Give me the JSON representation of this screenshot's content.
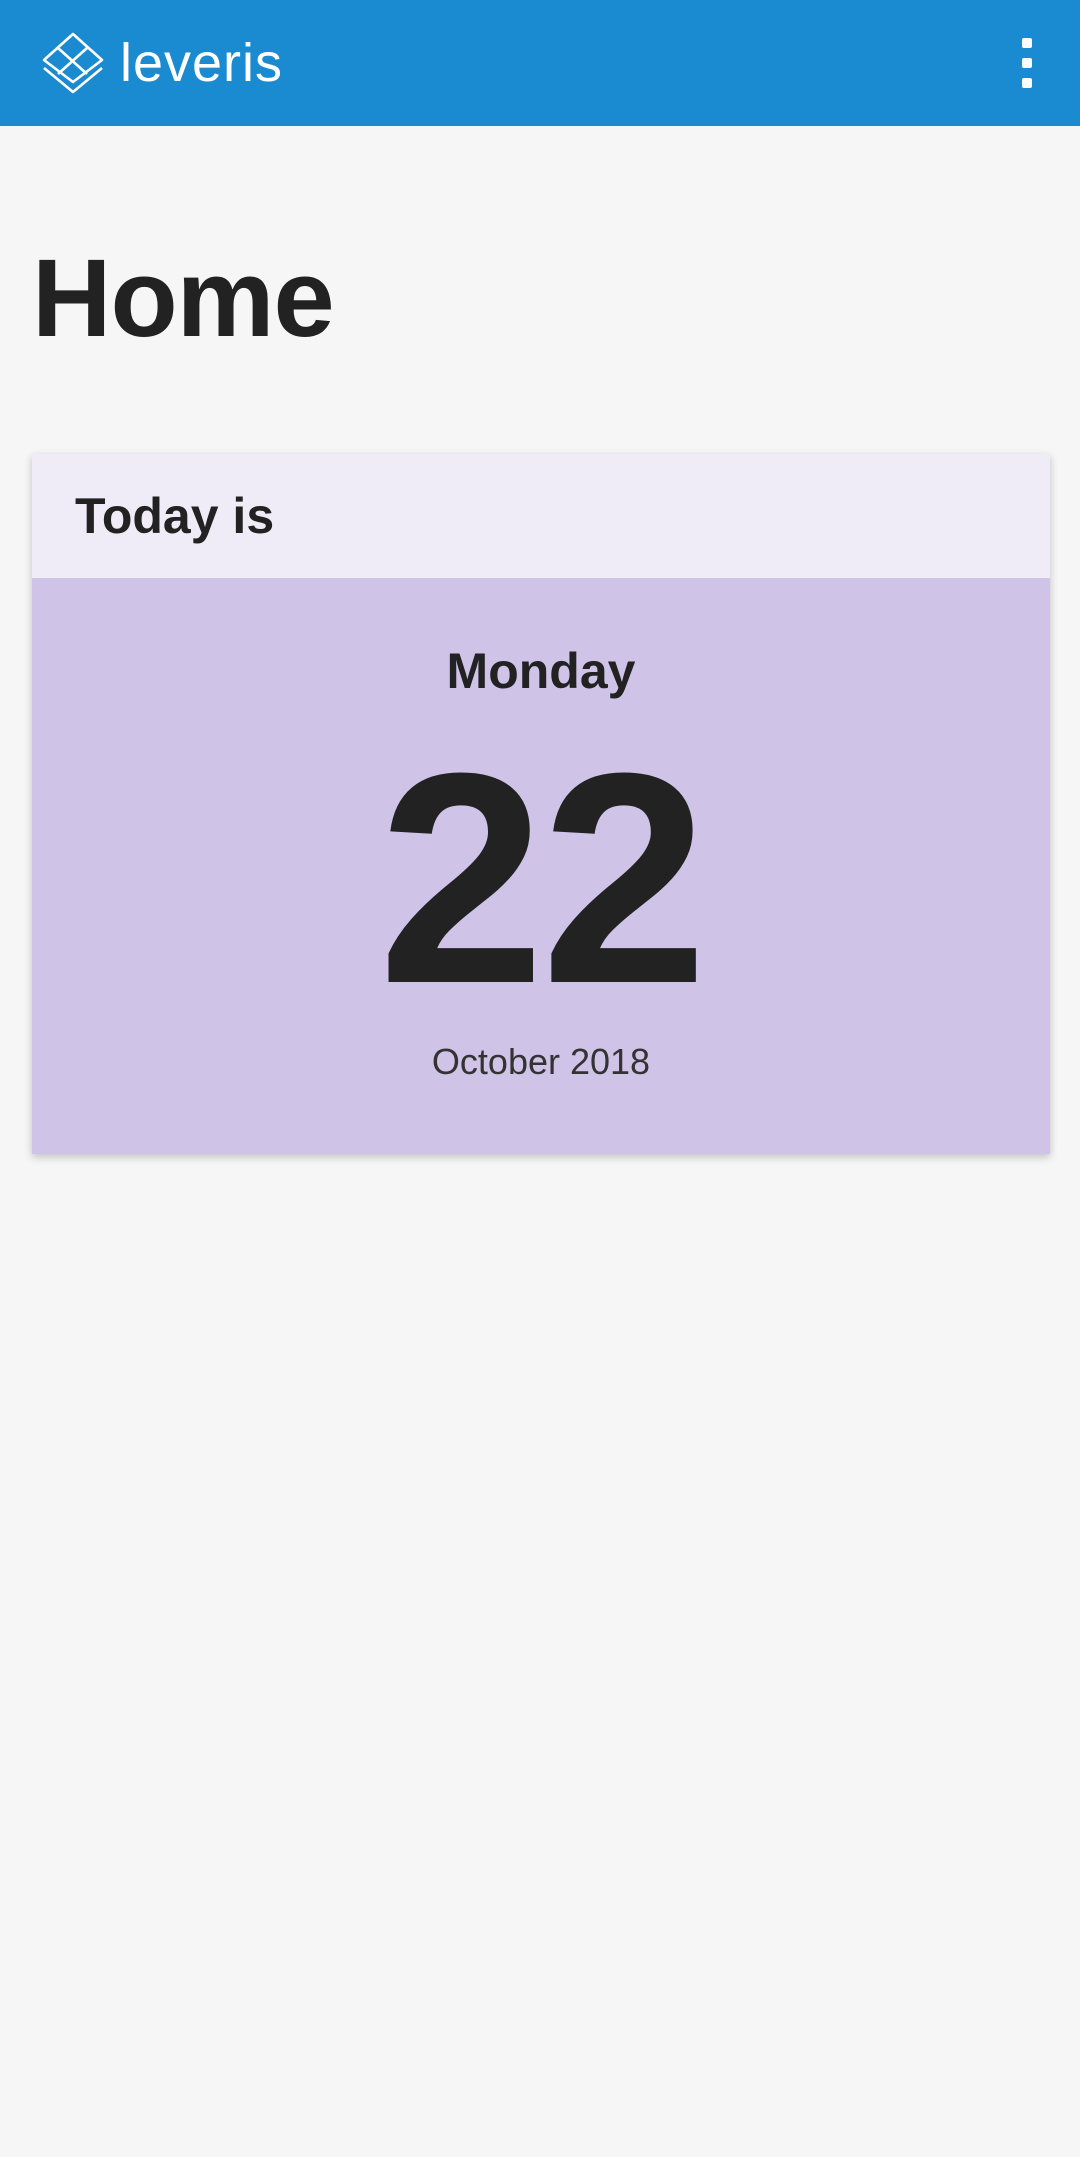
{
  "app_bar": {
    "brand_name": "leveris",
    "logo_icon": "leveris-diamond-logo",
    "menu_icon": "more-vert-icon",
    "background_color": "#1a8ad1"
  },
  "page": {
    "title": "Home"
  },
  "date_card": {
    "header_label": "Today is",
    "weekday": "Monday",
    "day": "22",
    "month_year": "October 2018",
    "header_color": "#efecf7",
    "body_color": "#d0c3e8"
  }
}
